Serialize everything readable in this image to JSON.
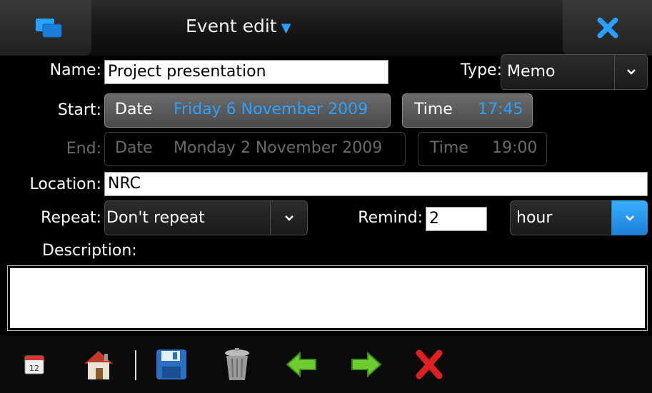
{
  "titlebar": {
    "title": "Event edit",
    "title_arrow": "▼"
  },
  "form": {
    "name_label": "Name:",
    "name_value": "Project presentation",
    "type_label": "Type:",
    "type_value": "Memo",
    "start_label": "Start:",
    "start_date_label": "Date",
    "start_date_value": "Friday  6 November 2009",
    "start_time_label": "Time",
    "start_time_value": "17:45",
    "end_label": "End:",
    "end_date_label": "Date",
    "end_date_value": "Monday  2 November 2009",
    "end_time_label": "Time",
    "end_time_value": "19:00",
    "location_label": "Location:",
    "location_value": "NRC",
    "repeat_label": "Repeat:",
    "repeat_value": "Don't repeat",
    "remind_label": "Remind:",
    "remind_value": "2",
    "remind_unit": "hour",
    "description_label": "Description:",
    "description_value": ""
  },
  "toolbar": {
    "calendar_day": "12",
    "items": [
      "calendar-icon",
      "home-icon",
      "save-icon",
      "trash-icon",
      "back-arrow-icon",
      "forward-arrow-icon",
      "delete-icon"
    ]
  },
  "colors": {
    "accent": "#2aa1ff",
    "background": "#000000",
    "disabled": "#6a6a6a"
  }
}
